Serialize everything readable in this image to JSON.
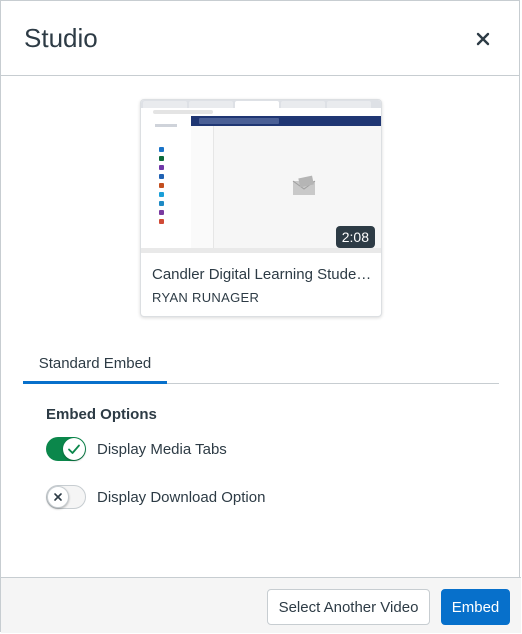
{
  "modal": {
    "title": "Studio",
    "close_icon": "close-icon"
  },
  "video": {
    "title": "Candler Digital Learning Studen...",
    "author": "RYAN RUNAGER",
    "duration": "2:08"
  },
  "tabs": [
    {
      "label": "Standard Embed",
      "active": true
    }
  ],
  "embed_options": {
    "heading": "Embed Options",
    "options": [
      {
        "label": "Display Media Tabs",
        "enabled": true
      },
      {
        "label": "Display Download Option",
        "enabled": false
      }
    ]
  },
  "footer": {
    "select_label": "Select Another Video",
    "embed_label": "Embed"
  },
  "colors": {
    "primary": "#0770cb",
    "toggle_on": "#0b874b",
    "text": "#2d3b45"
  }
}
